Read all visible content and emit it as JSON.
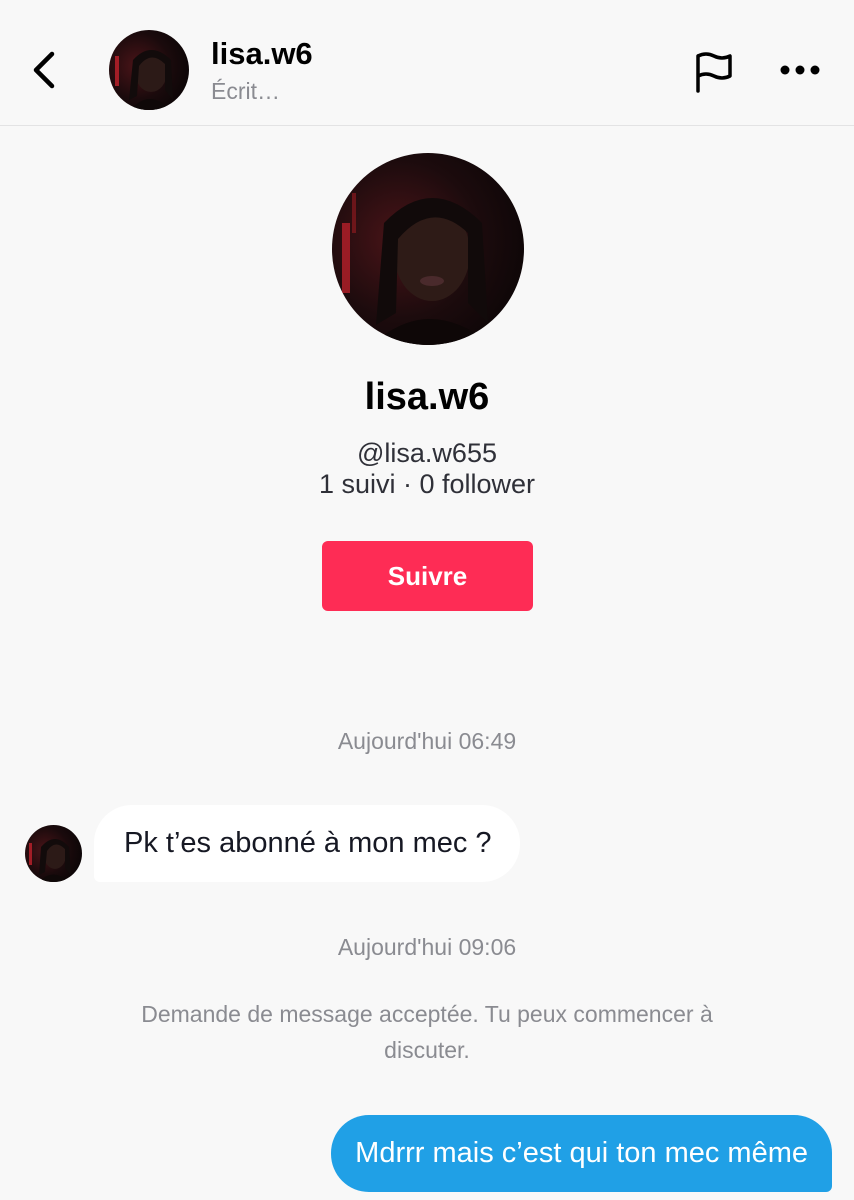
{
  "header": {
    "name": "lisa.w6",
    "status": "Écrit…"
  },
  "profile": {
    "name": "lisa.w6",
    "handle": "@lisa.w655",
    "stats": "1 suivi · 0 follower",
    "follow_label": "Suivre"
  },
  "icons": {
    "back": "chevron-left-icon",
    "report": "flag-icon",
    "more": "more-horizontal-icon"
  },
  "colors": {
    "follow_button": "#fe2c55",
    "outgoing_bubble": "#20a0e6"
  },
  "conversation": {
    "timestamp_1": "Aujourd'hui 06:49",
    "incoming_message": "Pk t’es abonné à mon mec ?",
    "timestamp_2": "Aujourd'hui 09:06",
    "system_message": "Demande de message acceptée. Tu peux commencer à discuter.",
    "outgoing_message": "Mdrrr mais c’est qui ton mec même"
  }
}
